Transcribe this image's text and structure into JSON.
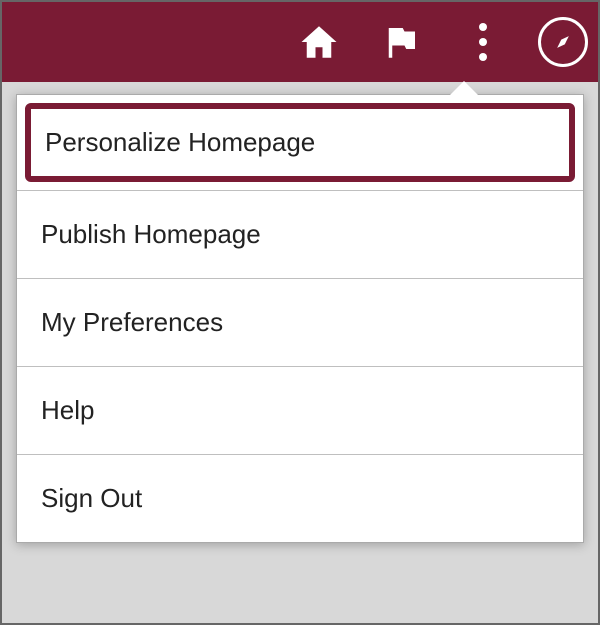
{
  "header": {
    "icons": {
      "home": "home-icon",
      "flag": "flag-icon",
      "kebab": "more-icon",
      "compass": "compass-icon"
    }
  },
  "menu": {
    "items": [
      {
        "label": "Personalize Homepage",
        "highlighted": true
      },
      {
        "label": "Publish Homepage"
      },
      {
        "label": "My Preferences"
      },
      {
        "label": "Help"
      },
      {
        "label": "Sign Out"
      }
    ]
  }
}
